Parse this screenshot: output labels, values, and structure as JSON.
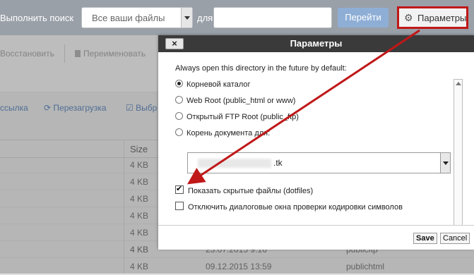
{
  "search": {
    "label": "Выполнить поиск",
    "scope": "Все ваши файлы",
    "for_label": "для",
    "query_value": "",
    "go": "Перейти"
  },
  "settings_button": {
    "icon": "gear-icon",
    "label": "Параметры"
  },
  "toolbar": {
    "restore": "Восстановить",
    "rename": "Переименовать",
    "link": "ссылка",
    "reload": "Перезагрузка",
    "select": "Выбр"
  },
  "table": {
    "size_header": "Size",
    "rows": [
      {
        "size": "4 KB",
        "date": "",
        "name": ""
      },
      {
        "size": "4 KB",
        "date": "",
        "name": ""
      },
      {
        "size": "4 KB",
        "date": "",
        "name": ""
      },
      {
        "size": "4 KB",
        "date": "",
        "name": ""
      },
      {
        "size": "4 KB",
        "date": "",
        "name": ""
      },
      {
        "size": "4 KB",
        "date": "",
        "name": ""
      },
      {
        "size": "4 KB",
        "date": "23.07.2015 9:16",
        "name": "publicftp"
      },
      {
        "size": "4 KB",
        "date": "09.12.2015 13:59",
        "name": "publichtml"
      }
    ]
  },
  "dialog": {
    "title": "Параметры",
    "close": "×",
    "intro": "Always open this directory in the future by default:",
    "options": [
      {
        "label": "Корневой каталог",
        "checked": true
      },
      {
        "label": "Web Root (public_html or www)",
        "checked": false
      },
      {
        "label": "Открытый FTP Root (public_ftp)",
        "checked": false
      },
      {
        "label": "Корень документа для:",
        "checked": false
      }
    ],
    "doc_root_value": ".tk",
    "show_hidden": {
      "label": "Показать скрытые файлы (dotfiles)",
      "checked": true
    },
    "disable_encoding": {
      "label": "Отключить диалоговые окна проверки кодировки символов",
      "checked": false
    },
    "save": "Save",
    "cancel": "Cancel"
  },
  "colors": {
    "annotation": "#c01818",
    "title_bar": "#3a3a3a",
    "topbar": "#9aa0a8"
  }
}
